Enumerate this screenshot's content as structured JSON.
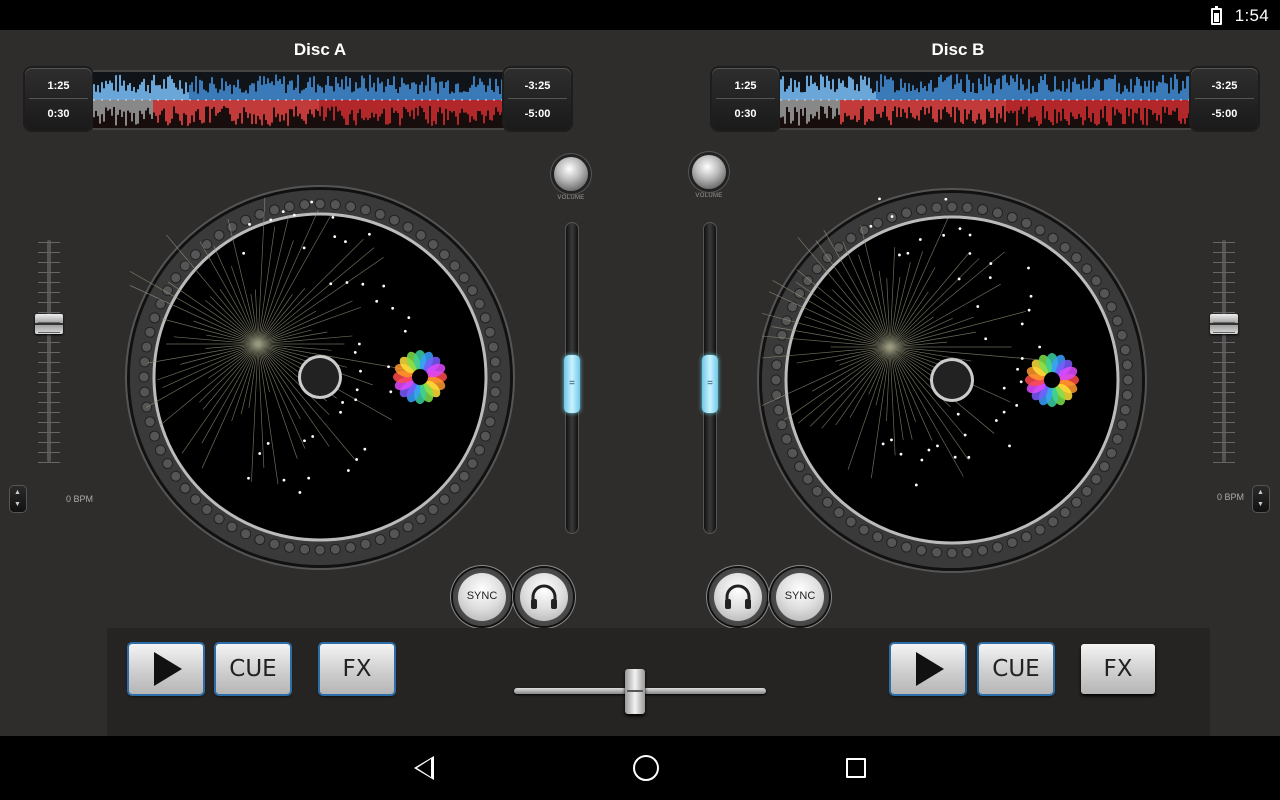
{
  "status_bar": {
    "time": "1:54",
    "battery_icon": "battery-charging-icon"
  },
  "deck_a": {
    "title": "Disc A",
    "time_top": "1:25",
    "time_bottom": "0:30",
    "remain_top": "-3:25",
    "remain_bottom": "-5:00",
    "bpm": "0 BPM",
    "volume_label": "VOLUME",
    "sync_label": "SYNC",
    "cue_label": "CUE",
    "fx_label": "FX",
    "pitch_level": 0.38,
    "volume_level": 0.6
  },
  "deck_b": {
    "title": "Disc B",
    "time_top": "1:25",
    "time_bottom": "0:30",
    "remain_top": "-3:25",
    "remain_bottom": "-5:00",
    "bpm": "0 BPM",
    "volume_label": "VOLUME",
    "sync_label": "SYNC",
    "cue_label": "CUE",
    "fx_label": "FX",
    "pitch_level": 0.38,
    "volume_level": 0.6
  },
  "crossfader": {
    "level": 0.48
  },
  "colors": {
    "background": "#2f2d2c",
    "wave_blue": "#3a7ab8",
    "wave_red": "#b2282a",
    "wave_played": "#888888",
    "volume_handle": "#8dd6f0",
    "active_button_border": "#2d6ea8"
  },
  "icons": {
    "play": "play-icon",
    "headphones": "headphones-icon",
    "back": "back-icon",
    "home": "home-icon",
    "recents": "recents-icon"
  }
}
